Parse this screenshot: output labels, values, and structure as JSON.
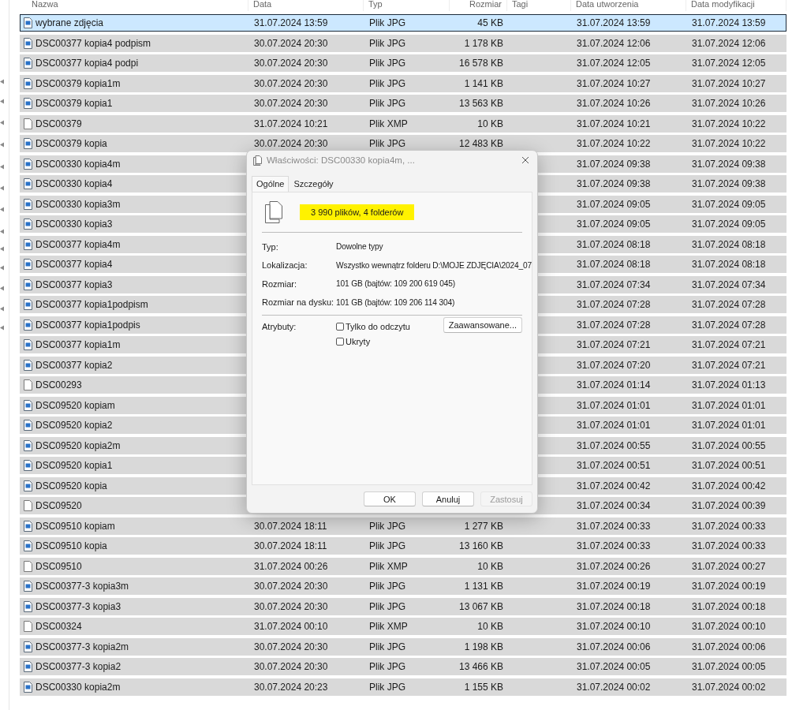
{
  "header": {
    "columns": [
      "Nazwa",
      "Data",
      "Typ",
      "Rozmiar",
      "Tagi",
      "Data utworzenia",
      "Data modyfikacji"
    ]
  },
  "rows": [
    {
      "kind": "jpg",
      "name": "wybrane zdjęcia",
      "date": "31.07.2024 13:59",
      "type": "Plik JPG",
      "size": "45 KB",
      "created": "31.07.2024 13:59",
      "modified": "31.07.2024 13:59",
      "selected": true,
      "focused": true
    },
    {
      "kind": "jpg",
      "name": "DSC00377 kopia4 podpism",
      "date": "30.07.2024 20:30",
      "type": "Plik JPG",
      "size": "1 178 KB",
      "created": "31.07.2024 12:06",
      "modified": "31.07.2024 12:06",
      "selected": true,
      "focused": false
    },
    {
      "kind": "jpg",
      "name": "DSC00377 kopia4 podpi",
      "date": "30.07.2024 20:30",
      "type": "Plik JPG",
      "size": "16 578 KB",
      "created": "31.07.2024 12:05",
      "modified": "31.07.2024 12:05",
      "selected": true,
      "focused": false
    },
    {
      "kind": "jpg",
      "name": "DSC00379 kopia1m",
      "date": "30.07.2024 20:30",
      "type": "Plik JPG",
      "size": "1 141 KB",
      "created": "31.07.2024 10:27",
      "modified": "31.07.2024 10:27",
      "selected": true,
      "focused": false
    },
    {
      "kind": "jpg",
      "name": "DSC00379 kopia1",
      "date": "30.07.2024 20:30",
      "type": "Plik JPG",
      "size": "13 563 KB",
      "created": "31.07.2024 10:26",
      "modified": "31.07.2024 10:26",
      "selected": true,
      "focused": false
    },
    {
      "kind": "xmp",
      "name": "DSC00379",
      "date": "31.07.2024 10:21",
      "type": "Plik XMP",
      "size": "10 KB",
      "created": "31.07.2024 10:21",
      "modified": "31.07.2024 10:22",
      "selected": true,
      "focused": false
    },
    {
      "kind": "jpg",
      "name": "DSC00379 kopia",
      "date": "30.07.2024 20:30",
      "type": "Plik JPG",
      "size": "12 483 KB",
      "created": "31.07.2024 10:22",
      "modified": "31.07.2024 10:22",
      "selected": true,
      "focused": false
    },
    {
      "kind": "jpg",
      "name": "DSC00330 kopia4m",
      "created": "31.07.2024 09:38",
      "modified": "31.07.2024 09:38",
      "selected": true,
      "focused": false
    },
    {
      "kind": "jpg",
      "name": "DSC00330 kopia4",
      "created": "31.07.2024 09:38",
      "modified": "31.07.2024 09:38",
      "selected": true,
      "focused": false
    },
    {
      "kind": "jpg",
      "name": "DSC00330 kopia3m",
      "created": "31.07.2024 09:05",
      "modified": "31.07.2024 09:05",
      "selected": true,
      "focused": false
    },
    {
      "kind": "jpg",
      "name": "DSC00330 kopia3",
      "created": "31.07.2024 09:05",
      "modified": "31.07.2024 09:05",
      "selected": true,
      "focused": false
    },
    {
      "kind": "jpg",
      "name": "DSC00377 kopia4m",
      "created": "31.07.2024 08:18",
      "modified": "31.07.2024 08:18",
      "selected": true,
      "focused": false
    },
    {
      "kind": "jpg",
      "name": "DSC00377 kopia4",
      "created": "31.07.2024 08:18",
      "modified": "31.07.2024 08:18",
      "selected": true,
      "focused": false
    },
    {
      "kind": "jpg",
      "name": "DSC00377 kopia3",
      "created": "31.07.2024 07:34",
      "modified": "31.07.2024 07:34",
      "selected": true,
      "focused": false
    },
    {
      "kind": "jpg",
      "name": "DSC00377 kopia1podpism",
      "created": "31.07.2024 07:28",
      "modified": "31.07.2024 07:28",
      "selected": true,
      "focused": false
    },
    {
      "kind": "jpg",
      "name": "DSC00377 kopia1podpis",
      "created": "31.07.2024 07:28",
      "modified": "31.07.2024 07:28",
      "selected": true,
      "focused": false
    },
    {
      "kind": "jpg",
      "name": "DSC00377 kopia1m",
      "created": "31.07.2024 07:21",
      "modified": "31.07.2024 07:21",
      "selected": true,
      "focused": false
    },
    {
      "kind": "jpg",
      "name": "DSC00377 kopia2",
      "created": "31.07.2024 07:20",
      "modified": "31.07.2024 07:21",
      "selected": true,
      "focused": false
    },
    {
      "kind": "xmp",
      "name": "DSC00293",
      "created": "31.07.2024 01:14",
      "modified": "31.07.2024 01:13",
      "selected": true,
      "focused": false
    },
    {
      "kind": "jpg",
      "name": "DSC09520 kopiam",
      "created": "31.07.2024 01:01",
      "modified": "31.07.2024 01:01",
      "selected": true,
      "focused": false
    },
    {
      "kind": "jpg",
      "name": "DSC09520 kopia2",
      "created": "31.07.2024 01:01",
      "modified": "31.07.2024 01:01",
      "selected": true,
      "focused": false
    },
    {
      "kind": "jpg",
      "name": "DSC09520 kopia2m",
      "created": "31.07.2024 00:55",
      "modified": "31.07.2024 00:55",
      "selected": true,
      "focused": false
    },
    {
      "kind": "jpg",
      "name": "DSC09520 kopia1",
      "created": "31.07.2024 00:51",
      "modified": "31.07.2024 00:51",
      "selected": true,
      "focused": false
    },
    {
      "kind": "jpg",
      "name": "DSC09520 kopia",
      "created": "31.07.2024 00:42",
      "modified": "31.07.2024 00:42",
      "selected": true,
      "focused": false
    },
    {
      "kind": "xmp",
      "name": "DSC09520",
      "created": "31.07.2024 00:34",
      "modified": "31.07.2024 00:39",
      "selected": true,
      "focused": false
    },
    {
      "kind": "jpg",
      "name": "DSC09510 kopiam",
      "date": "30.07.2024 18:11",
      "type": "Plik JPG",
      "size": "1 277 KB",
      "created": "31.07.2024 00:33",
      "modified": "31.07.2024 00:33",
      "selected": true,
      "focused": false
    },
    {
      "kind": "jpg",
      "name": "DSC09510 kopia",
      "date": "30.07.2024 18:11",
      "type": "Plik JPG",
      "size": "13 160 KB",
      "created": "31.07.2024 00:33",
      "modified": "31.07.2024 00:33",
      "selected": true,
      "focused": false
    },
    {
      "kind": "xmp",
      "name": "DSC09510",
      "date": "31.07.2024 00:26",
      "type": "Plik XMP",
      "size": "10 KB",
      "created": "31.07.2024 00:26",
      "modified": "31.07.2024 00:27",
      "selected": true,
      "focused": false
    },
    {
      "kind": "jpg",
      "name": "DSC00377-3 kopia3m",
      "date": "30.07.2024 20:30",
      "type": "Plik JPG",
      "size": "1 131 KB",
      "created": "31.07.2024 00:19",
      "modified": "31.07.2024 00:19",
      "selected": true,
      "focused": false
    },
    {
      "kind": "jpg",
      "name": "DSC00377-3 kopia3",
      "date": "30.07.2024 20:30",
      "type": "Plik JPG",
      "size": "13 067 KB",
      "created": "31.07.2024 00:18",
      "modified": "31.07.2024 00:18",
      "selected": true,
      "focused": false
    },
    {
      "kind": "xmp",
      "name": "DSC00324",
      "date": "31.07.2024 00:10",
      "type": "Plik XMP",
      "size": "10 KB",
      "created": "31.07.2024 00:10",
      "modified": "31.07.2024 00:10",
      "selected": true,
      "focused": false
    },
    {
      "kind": "jpg",
      "name": "DSC00377-3 kopia2m",
      "date": "30.07.2024 20:30",
      "type": "Plik JPG",
      "size": "1 198 KB",
      "created": "31.07.2024 00:06",
      "modified": "31.07.2024 00:06",
      "selected": true,
      "focused": false
    },
    {
      "kind": "jpg",
      "name": "DSC00377-3 kopia2",
      "date": "30.07.2024 20:30",
      "type": "Plik JPG",
      "size": "13 466 KB",
      "created": "31.07.2024 00:05",
      "modified": "31.07.2024 00:05",
      "selected": true,
      "focused": false
    },
    {
      "kind": "jpg",
      "name": "DSC00330 kopia2m",
      "date": "30.07.2024 20:23",
      "type": "Plik JPG",
      "size": "1 155 KB",
      "created": "31.07.2024 00:02",
      "modified": "31.07.2024 00:02",
      "selected": true,
      "focused": false
    }
  ],
  "dialog": {
    "title": "Właściwości: DSC00330 kopia4m, ...",
    "tabs": [
      {
        "label": "Ogólne",
        "selected": true
      },
      {
        "label": "Szczegóły",
        "selected": false
      }
    ],
    "summary": "3 990 plików, 4 folderów",
    "properties": [
      {
        "label": "Typ:",
        "value": "Dowolne typy"
      },
      {
        "label": "Lokalizacja:",
        "value": "Wszystko wewnątrz folderu D:\\MOJE ZDJĘCIA\\2024_07"
      },
      {
        "label": "Rozmiar:",
        "value": "101 GB (bajtów: 109 200 619 045)"
      },
      {
        "label": "Rozmiar na dysku:",
        "value": "101 GB (bajtów: 109 206 114 304)"
      }
    ],
    "attributes_label": "Atrybuty:",
    "attributes": [
      {
        "label": "Tylko do odczytu",
        "checked": false
      },
      {
        "label": "Ukryty",
        "checked": false
      }
    ],
    "advanced_button": "Zaawansowane...",
    "buttons": [
      {
        "label": "OK",
        "disabled": false
      },
      {
        "label": "Anuluj",
        "disabled": false
      },
      {
        "label": "Zastosuj",
        "disabled": true
      }
    ]
  }
}
